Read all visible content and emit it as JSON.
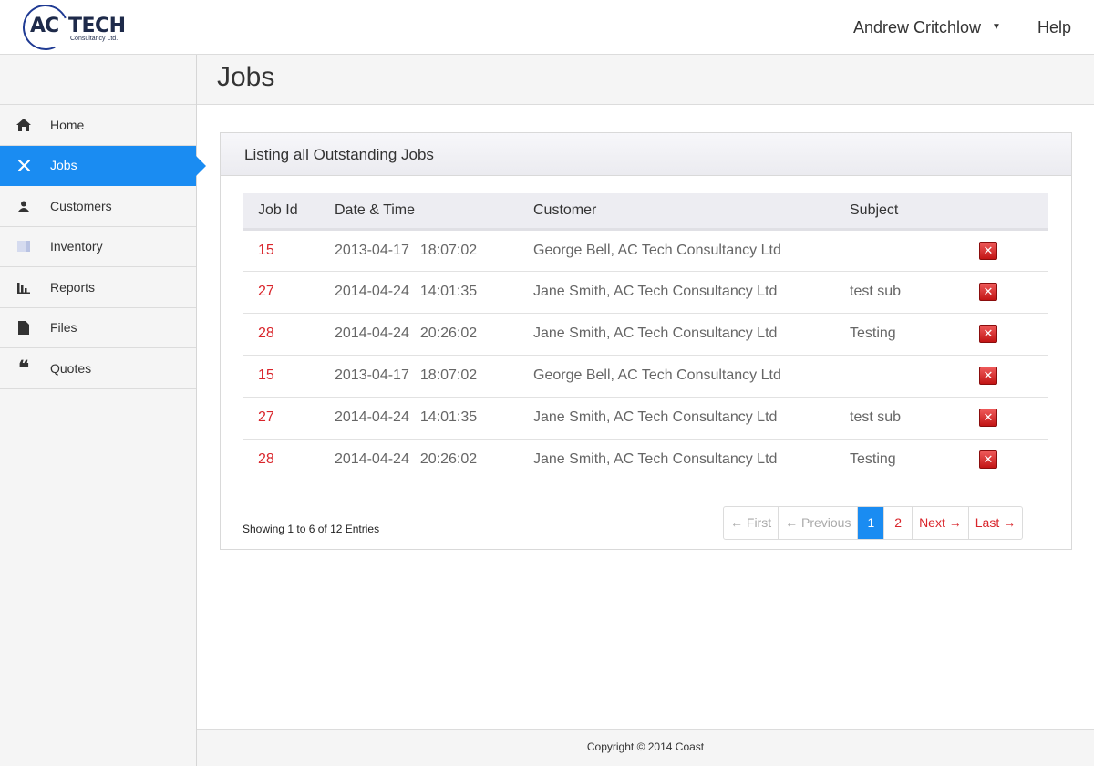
{
  "brand": {
    "logo_main": "AC",
    "logo_tech": "TECH",
    "logo_sub": "Consultancy Ltd."
  },
  "header": {
    "user_name": "Andrew Critchlow",
    "help": "Help"
  },
  "sidebar": {
    "items": [
      {
        "label": "Home",
        "icon": "home-icon"
      },
      {
        "label": "Jobs",
        "icon": "tools-icon"
      },
      {
        "label": "Customers",
        "icon": "user-icon"
      },
      {
        "label": "Inventory",
        "icon": "box-icon"
      },
      {
        "label": "Reports",
        "icon": "bar-chart-icon"
      },
      {
        "label": "Files",
        "icon": "file-icon"
      },
      {
        "label": "Quotes",
        "icon": "quote-icon"
      }
    ]
  },
  "page": {
    "title": "Jobs"
  },
  "panel": {
    "heading": "Listing all Outstanding Jobs",
    "columns": [
      "Job Id",
      "Date & Time",
      "Customer",
      "Subject"
    ],
    "rows": [
      {
        "id": "15",
        "date": "2013-04-17",
        "time": "18:07:02",
        "customer": "George Bell, AC Tech Consultancy Ltd",
        "subject": ""
      },
      {
        "id": "27",
        "date": "2014-04-24",
        "time": "14:01:35",
        "customer": "Jane Smith, AC Tech Consultancy Ltd",
        "subject": "test sub"
      },
      {
        "id": "28",
        "date": "2014-04-24",
        "time": "20:26:02",
        "customer": "Jane Smith, AC Tech Consultancy Ltd",
        "subject": "Testing"
      },
      {
        "id": "15",
        "date": "2013-04-17",
        "time": "18:07:02",
        "customer": "George Bell, AC Tech Consultancy Ltd",
        "subject": ""
      },
      {
        "id": "27",
        "date": "2014-04-24",
        "time": "14:01:35",
        "customer": "Jane Smith, AC Tech Consultancy Ltd",
        "subject": "test sub"
      },
      {
        "id": "28",
        "date": "2014-04-24",
        "time": "20:26:02",
        "customer": "Jane Smith, AC Tech Consultancy Ltd",
        "subject": "Testing"
      }
    ],
    "entries": "Showing 1 to 6 of 12 Entries",
    "pager": {
      "first": "← First",
      "previous": "← Previous",
      "page1": "1",
      "page2": "2",
      "next": "Next →",
      "last": "Last →"
    }
  },
  "footer": {
    "copyright": "Copyright © 2014 Coast"
  },
  "colors": {
    "accent": "#1a8cf2",
    "link_red": "#d9252b"
  }
}
